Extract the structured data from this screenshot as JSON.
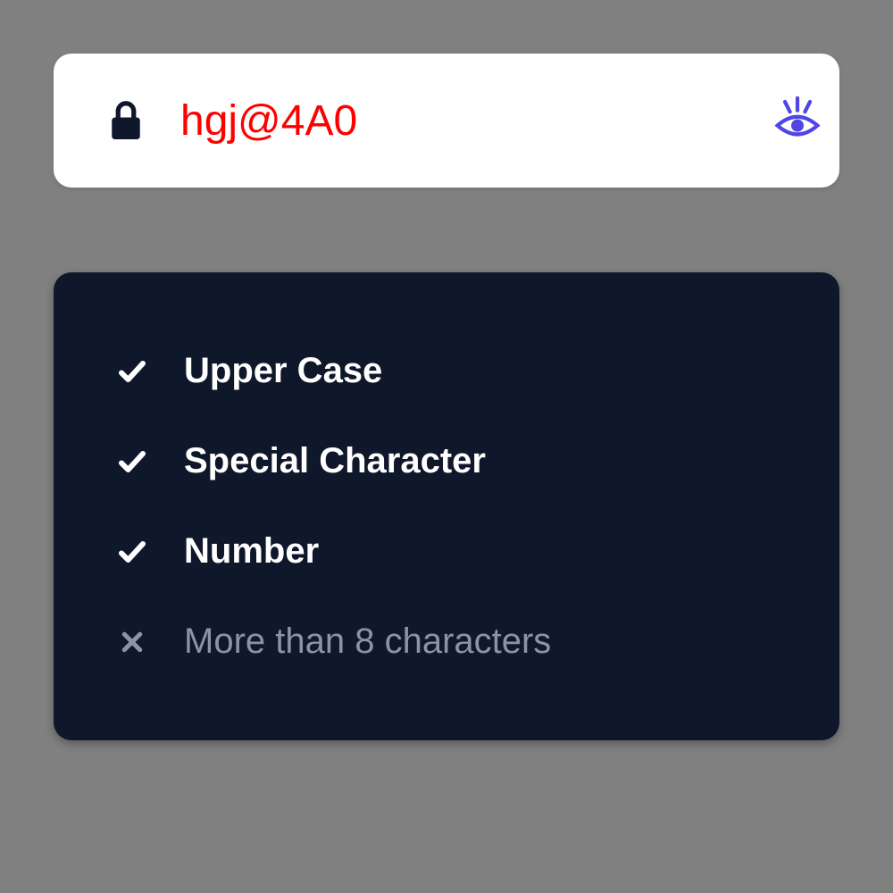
{
  "password": {
    "value": "hgj@4A0"
  },
  "rules": [
    {
      "label": "Upper Case",
      "met": true
    },
    {
      "label": "Special Character",
      "met": true
    },
    {
      "label": "Number",
      "met": true
    },
    {
      "label": "More than 8 characters",
      "met": false
    }
  ],
  "colors": {
    "input_text": "#ff0000",
    "eye_icon": "#4f46e5",
    "panel_bg": "#0f172a",
    "met_text": "#ffffff",
    "unmet_text": "#8a94a6"
  }
}
